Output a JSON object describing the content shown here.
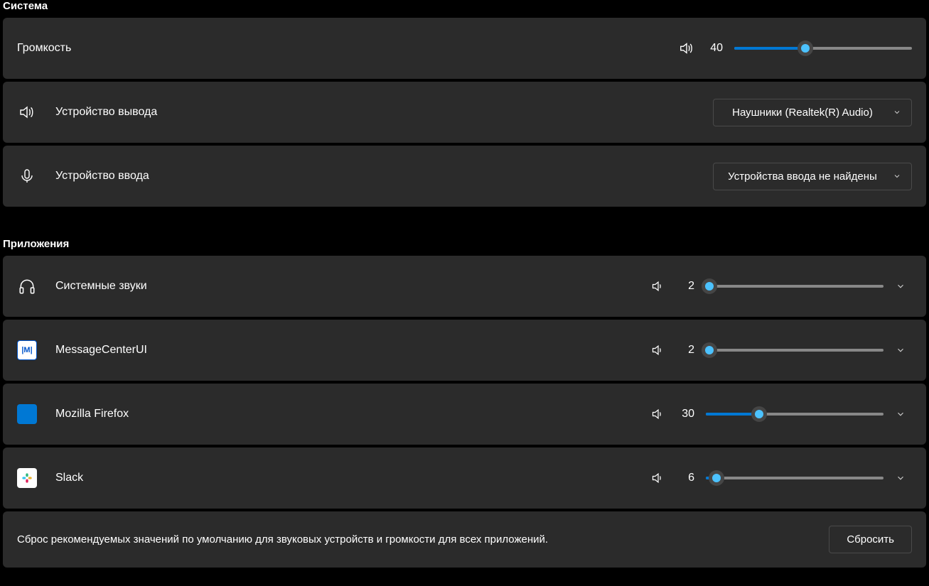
{
  "system": {
    "header": "Система",
    "volume": {
      "label": "Громкость",
      "value": 40
    },
    "output_device": {
      "label": "Устройство вывода",
      "selected": "Наушники (Realtek(R) Audio)"
    },
    "input_device": {
      "label": "Устройство ввода",
      "selected": "Устройства ввода не найдены"
    }
  },
  "apps": {
    "header": "Приложения",
    "items": [
      {
        "name": "Системные звуки",
        "volume": 2,
        "icon": "headphones"
      },
      {
        "name": "MessageCenterUI",
        "volume": 2,
        "icon": "message-center"
      },
      {
        "name": "Mozilla Firefox",
        "volume": 30,
        "icon": "firefox"
      },
      {
        "name": "Slack",
        "volume": 6,
        "icon": "slack"
      }
    ]
  },
  "reset": {
    "text": "Сброс рекомендуемых значений по умолчанию для звуковых устройств и громкости для всех приложений.",
    "button": "Сбросить"
  }
}
